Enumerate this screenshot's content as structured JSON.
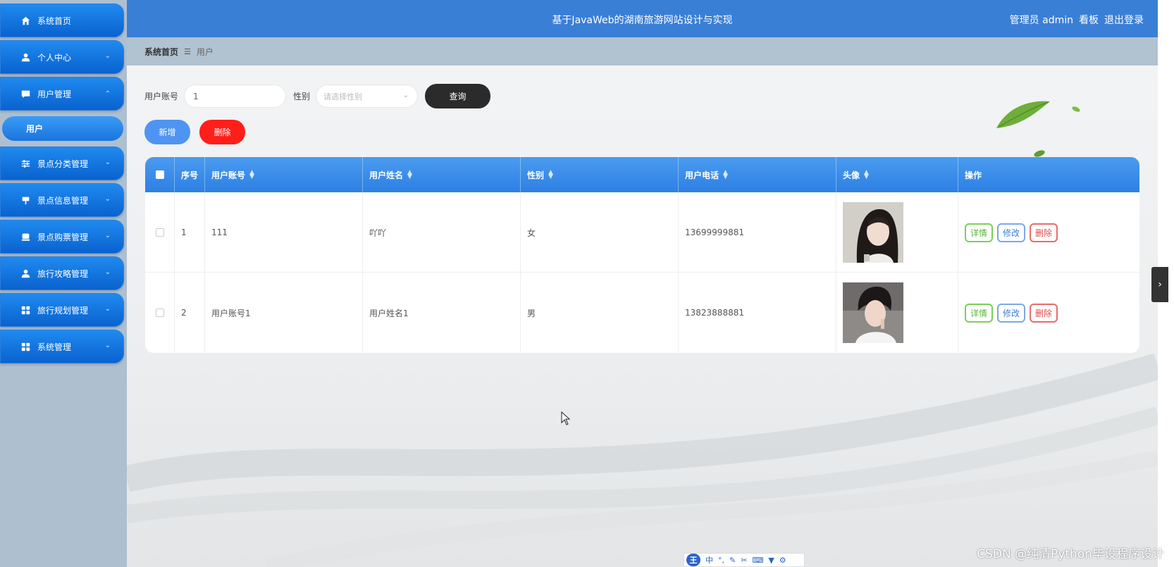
{
  "app": {
    "title": "基于JavaWeb的湖南旅游网站设计与实现",
    "user_label": "管理员 admin",
    "board_link": "看板",
    "logout_link": "退出登录"
  },
  "sidebar": {
    "items": [
      {
        "label": "系统首页",
        "icon": "home-icon",
        "has_arrow": false
      },
      {
        "label": "个人中心",
        "icon": "user-icon",
        "has_arrow": true
      },
      {
        "label": "用户管理",
        "icon": "chat-icon",
        "has_arrow": true,
        "expanded": true
      },
      {
        "label": "景点分类管理",
        "icon": "sliders-icon",
        "has_arrow": true
      },
      {
        "label": "景点信息管理",
        "icon": "sign-icon",
        "has_arrow": true
      },
      {
        "label": "景点购票管理",
        "icon": "ticket-icon",
        "has_arrow": true
      },
      {
        "label": "旅行攻略管理",
        "icon": "user-icon",
        "has_arrow": true
      },
      {
        "label": "旅行规划管理",
        "icon": "grid-icon",
        "has_arrow": true
      },
      {
        "label": "系统管理",
        "icon": "grid-icon",
        "has_arrow": true
      }
    ],
    "sub_item": {
      "label": "用户"
    },
    "arrow_down": "⌄",
    "arrow_up": "⌃"
  },
  "breadcrumb": {
    "home": "系统首页",
    "separator": "☰",
    "current": "用户"
  },
  "search": {
    "account_label": "用户账号",
    "account_value": "1",
    "gender_label": "性别",
    "gender_placeholder": "请选择性别",
    "query_button": "查询"
  },
  "actions": {
    "add_button": "新增",
    "delete_button": "删除"
  },
  "table": {
    "columns": [
      "序号",
      "用户账号",
      "用户姓名",
      "性别",
      "用户电话",
      "头像",
      "操作"
    ],
    "rows": [
      {
        "index": "1",
        "account": "111",
        "name": "吖吖",
        "gender": "女",
        "phone": "13699999881"
      },
      {
        "index": "2",
        "account": "用户账号1",
        "name": "用户姓名1",
        "gender": "男",
        "phone": "13823888881"
      }
    ],
    "row_actions": {
      "detail": "详情",
      "edit": "修改",
      "remove": "删除"
    }
  },
  "ime": {
    "logo": "王",
    "mode": "中"
  },
  "watermark": "CSDN @纯清Python毕设程序设计",
  "colors": {
    "accent": "#3a7fd6",
    "sidebar_item": "#1478e6",
    "danger": "#ff1f1a",
    "dark_button": "#2b2b2b"
  }
}
